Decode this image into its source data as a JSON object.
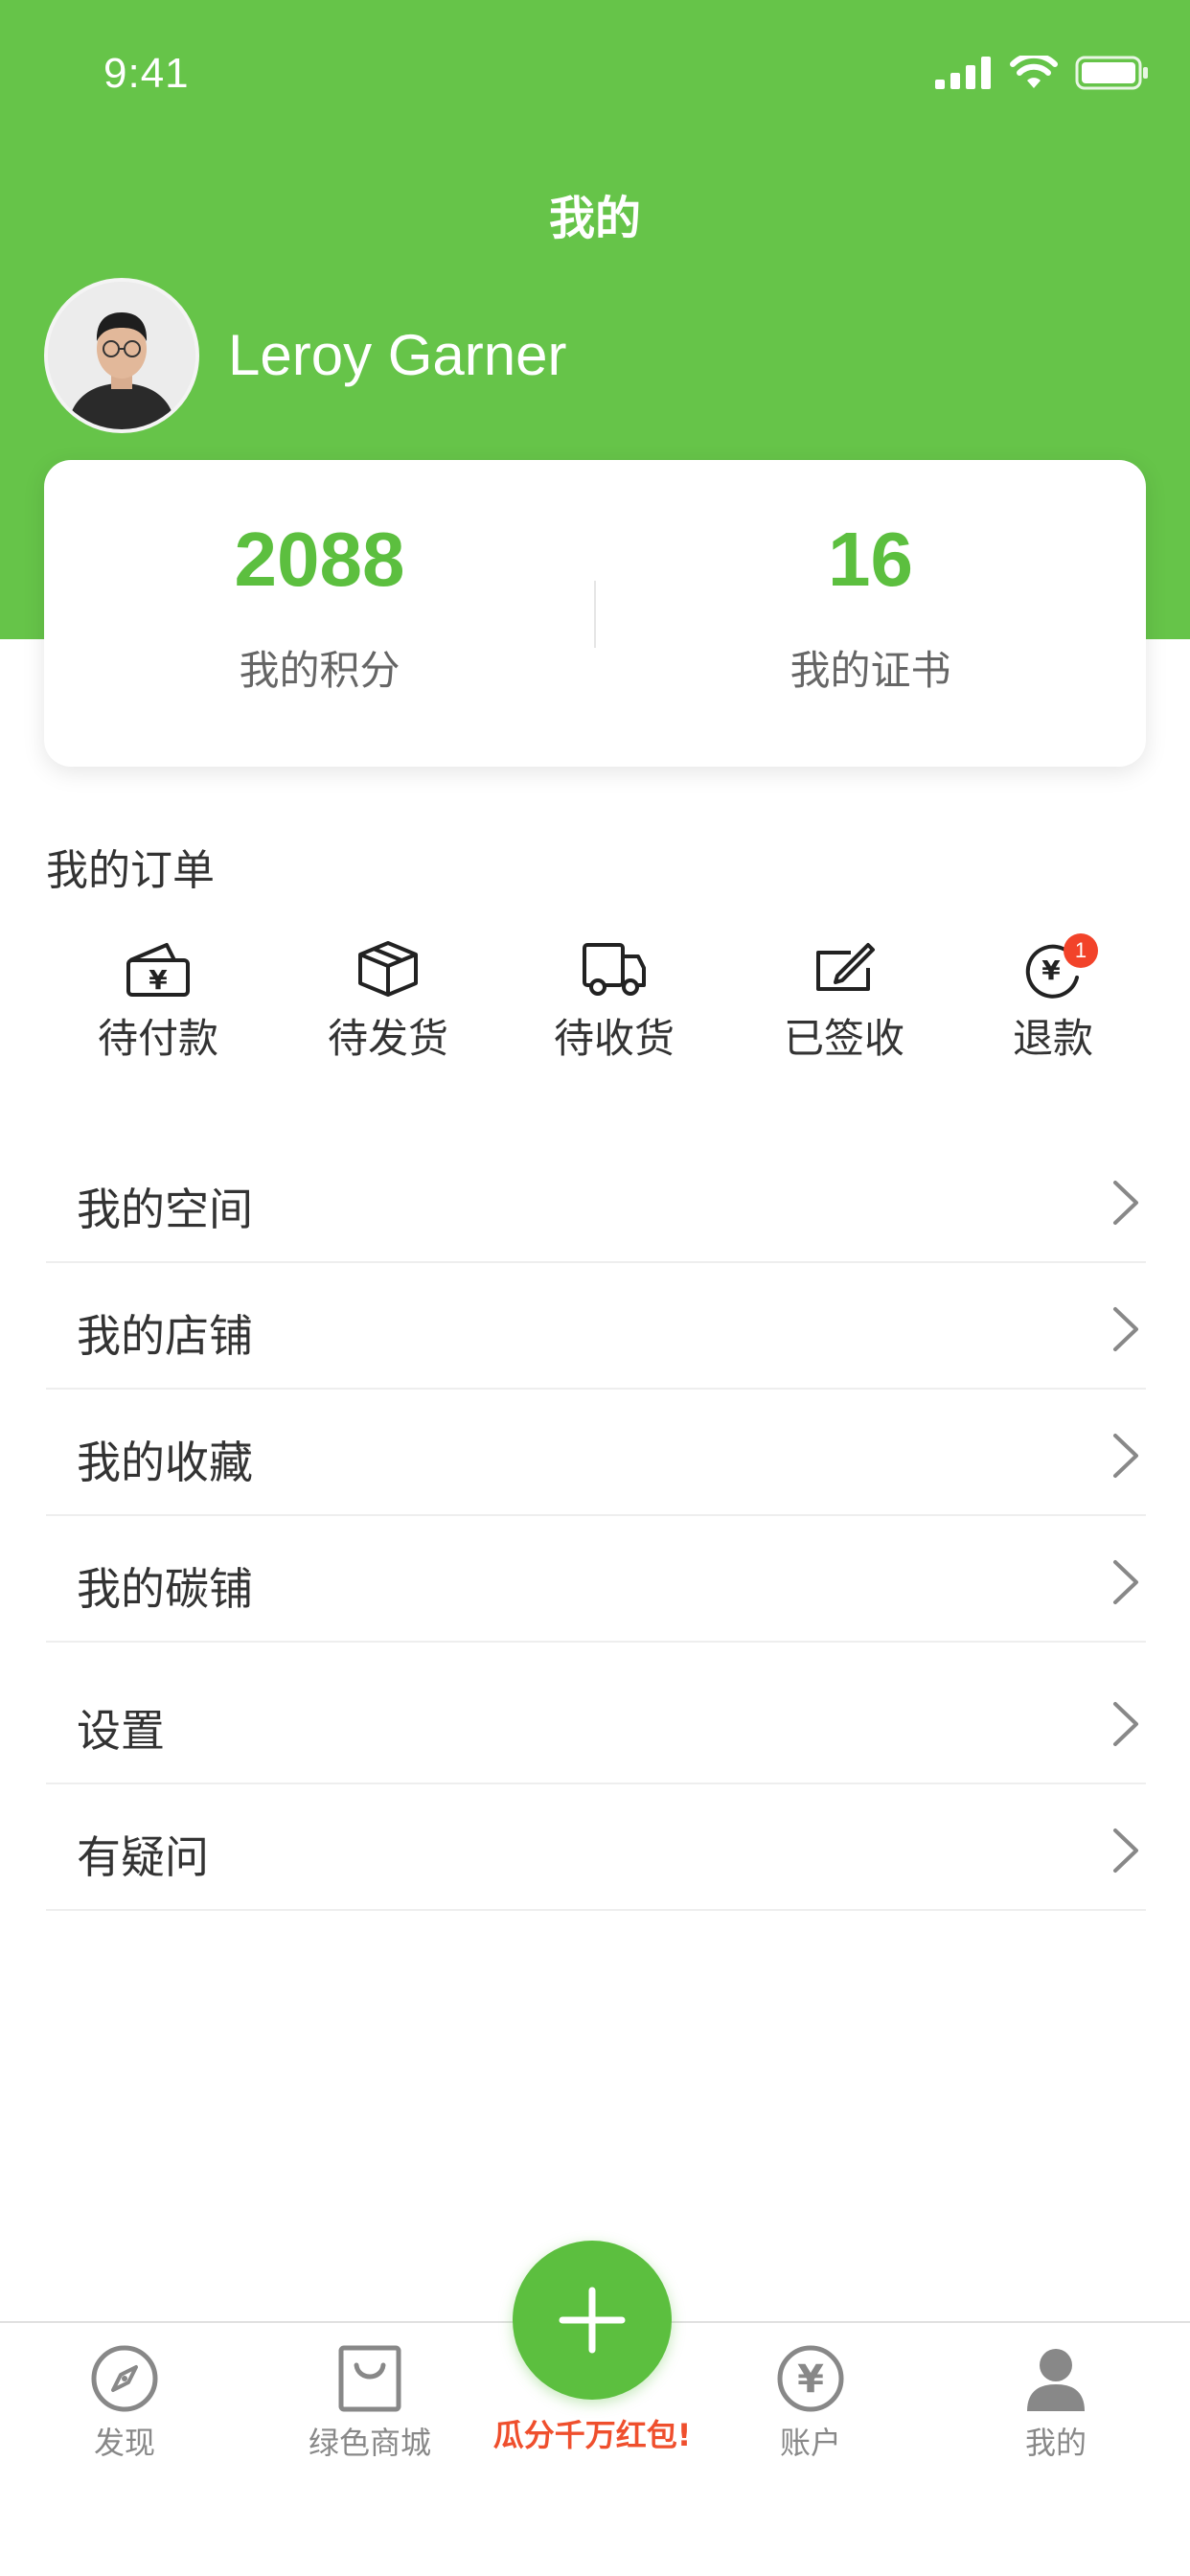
{
  "status_bar": {
    "time": "9:41"
  },
  "header": {
    "title": "我的"
  },
  "user": {
    "name": "Leroy Garner"
  },
  "stats": [
    {
      "value": "2088",
      "label": "我的积分"
    },
    {
      "value": "16",
      "label": "我的证书"
    }
  ],
  "orders": {
    "title": "我的订单",
    "items": [
      {
        "label": "待付款",
        "icon": "wallet-yuan-icon"
      },
      {
        "label": "待发货",
        "icon": "package-icon"
      },
      {
        "label": "待收货",
        "icon": "truck-icon"
      },
      {
        "label": "已签收",
        "icon": "signed-icon"
      },
      {
        "label": "退款",
        "icon": "refund-icon",
        "badge": "1"
      }
    ]
  },
  "menu": [
    {
      "label": "我的空间"
    },
    {
      "label": "我的店铺"
    },
    {
      "label": "我的收藏"
    },
    {
      "label": "我的碳铺"
    },
    {
      "label": "设置"
    },
    {
      "label": "有疑问"
    }
  ],
  "tab_bar": {
    "tabs": [
      {
        "label": "发现",
        "icon": "compass-icon"
      },
      {
        "label": "绿色商城",
        "icon": "shopping-bag-icon"
      },
      {
        "label": "账户",
        "icon": "yuan-circle-icon"
      },
      {
        "label": "我的",
        "icon": "person-icon"
      }
    ],
    "center_label": "瓜分千万红包!"
  },
  "colors": {
    "primary": "#66c449",
    "accent_text": "#5cbf3f",
    "badge": "#f2432a",
    "promo": "#ef4f2d"
  }
}
